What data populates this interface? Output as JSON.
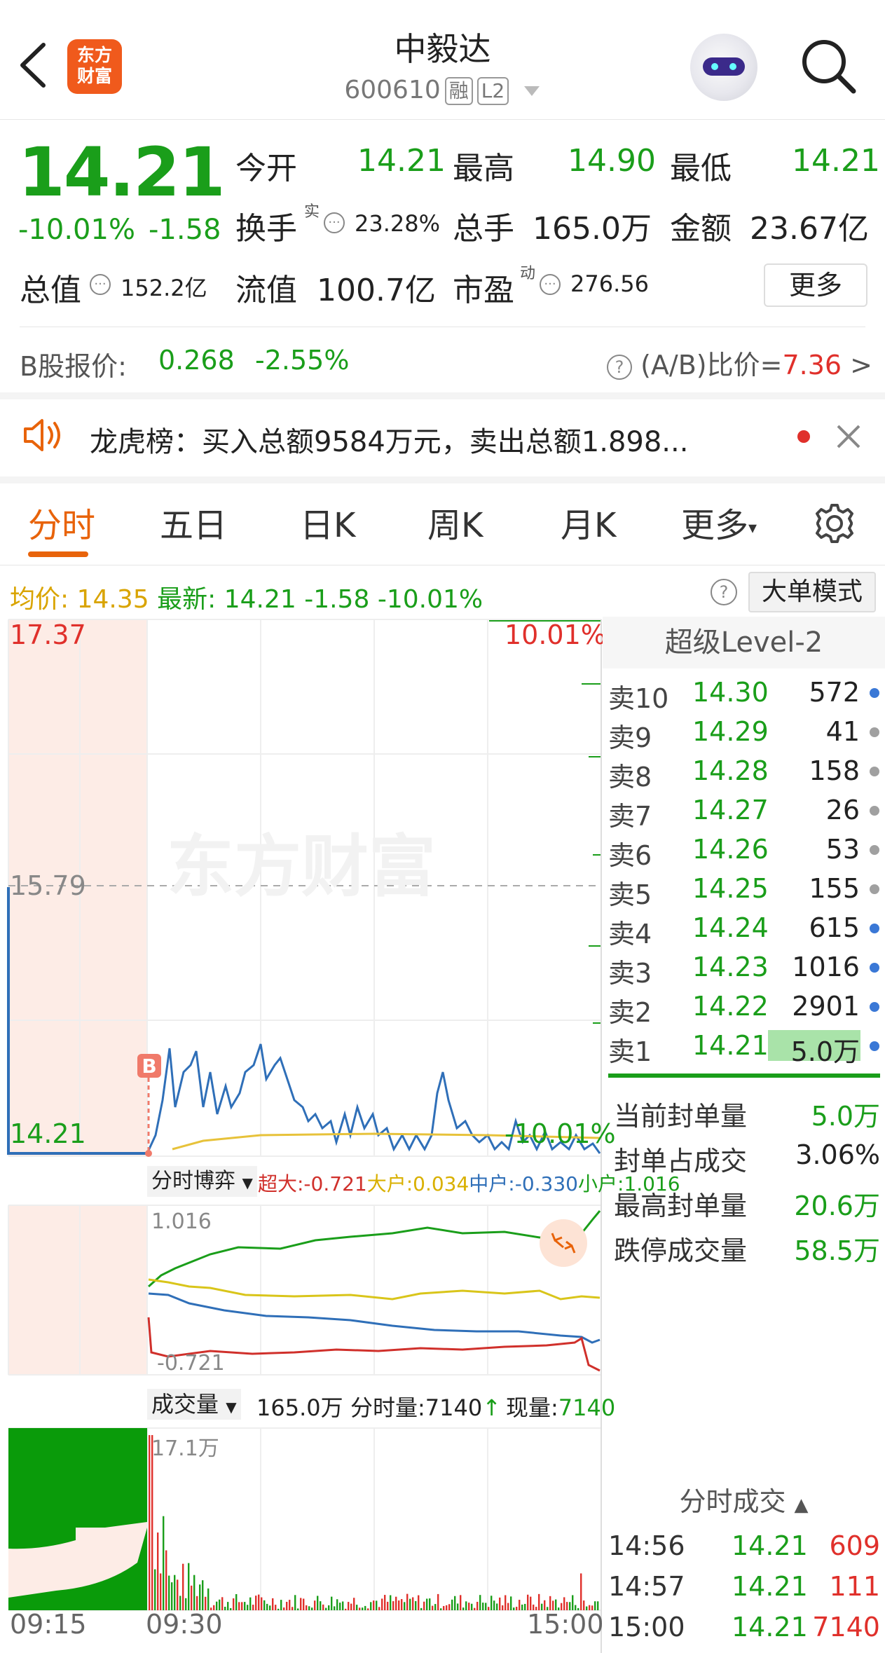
{
  "header": {
    "logo_line1": "东方",
    "logo_line2": "财富",
    "stock_name": "中毅达",
    "stock_code": "600610",
    "tag_margin": "融",
    "tag_level": "L2"
  },
  "quote": {
    "price": "14.21",
    "change_pct": "-10.01%",
    "change": "-1.58",
    "open_label": "今开",
    "open_value": "14.21",
    "high_label": "最高",
    "high_value": "14.90",
    "low_label": "最低",
    "low_value": "14.21",
    "turnover_label": "换手",
    "turnover_sup": "实",
    "turnover_value": "23.28%",
    "volume_label": "总手",
    "volume_value": "165.0万",
    "amount_label": "金额",
    "amount_value": "23.67亿",
    "mktcap_label": "总值",
    "mktcap_value": "152.2亿",
    "float_label": "流值",
    "float_value": "100.7亿",
    "pe_label": "市盈",
    "pe_sup": "动",
    "pe_value": "276.56",
    "more_button": "更多"
  },
  "bshare": {
    "label": "B股报价:",
    "price": "0.268",
    "change": "-2.55%",
    "ratio_label": "(A/B)比价=",
    "ratio_value": "7.36",
    "arrow": ">"
  },
  "notice": {
    "text": "龙虎榜：买入总额9584万元，卖出总额1.898..."
  },
  "tabs": [
    {
      "label": "分时"
    },
    {
      "label": "五日"
    },
    {
      "label": "日K"
    },
    {
      "label": "周K"
    },
    {
      "label": "月K"
    },
    {
      "label": "更多"
    }
  ],
  "info_bar": {
    "avg_label": "均价:",
    "avg_value": "14.35",
    "last_label": "最新:",
    "last_value": "14.21",
    "last_change": "-1.58",
    "last_pct": "-10.01%",
    "mode_button": "大单模式"
  },
  "chart": {
    "y_top": "17.37",
    "y_mid": "15.79",
    "y_bottom": "14.21",
    "pct_top": "10.01%",
    "pct_bottom": "-10.01%",
    "watermark": "东方财富",
    "b_marker": "B",
    "game_selector": "分时博弈",
    "game_super": "超大:-0.721",
    "game_big": "大户:0.034",
    "game_mid": "中户:-0.330",
    "game_small": "小户:1.016",
    "game_max": "1.016",
    "game_min": "-0.721",
    "vol_selector": "成交量",
    "vol_total": "165.0万",
    "vol_minute": "分时量:7140",
    "vol_now_label": "现量:",
    "vol_now": "7140",
    "vol_max": "17.1万",
    "time_start": "09:15",
    "time_open": "09:30",
    "time_end": "15:00"
  },
  "chart_data": {
    "type": "line",
    "x_range": [
      "09:15",
      "15:00"
    ],
    "ylim": [
      14.21,
      17.37
    ],
    "prev_close": 15.79,
    "series": []
  },
  "level2": {
    "title": "超级Level-2",
    "asks": [
      {
        "label": "卖10",
        "price": "14.30",
        "qty": "572",
        "dot": "#3a78d6"
      },
      {
        "label": "卖9",
        "price": "14.29",
        "qty": "41",
        "dot": "#a0a0a0"
      },
      {
        "label": "卖8",
        "price": "14.28",
        "qty": "158",
        "dot": "#a0a0a0"
      },
      {
        "label": "卖7",
        "price": "14.27",
        "qty": "26",
        "dot": "#a0a0a0"
      },
      {
        "label": "卖6",
        "price": "14.26",
        "qty": "53",
        "dot": "#a0a0a0"
      },
      {
        "label": "卖5",
        "price": "14.25",
        "qty": "155",
        "dot": "#a0a0a0"
      },
      {
        "label": "卖4",
        "price": "14.24",
        "qty": "615",
        "dot": "#3a78d6"
      },
      {
        "label": "卖3",
        "price": "14.23",
        "qty": "1016",
        "dot": "#3a78d6"
      },
      {
        "label": "卖2",
        "price": "14.22",
        "qty": "2901",
        "dot": "#3a78d6"
      },
      {
        "label": "卖1",
        "price": "14.21",
        "qty": "5.0万",
        "dot": "#3a78d6"
      }
    ],
    "stats": [
      {
        "label": "当前封单量",
        "value": "5.0万",
        "color": "#1a9e1a"
      },
      {
        "label": "封单占成交",
        "value": "3.06%",
        "color": "#222"
      },
      {
        "label": "最高封单量",
        "value": "20.6万",
        "color": "#1a9e1a"
      },
      {
        "label": "跌停成交量",
        "value": "58.5万",
        "color": "#1a9e1a"
      }
    ],
    "trades_title": "分时成交",
    "trades": [
      {
        "time": "14:56",
        "price": "14.21",
        "qty": "609"
      },
      {
        "time": "14:57",
        "price": "14.21",
        "qty": "111"
      },
      {
        "time": "15:00",
        "price": "14.21",
        "qty": "7140"
      }
    ]
  }
}
